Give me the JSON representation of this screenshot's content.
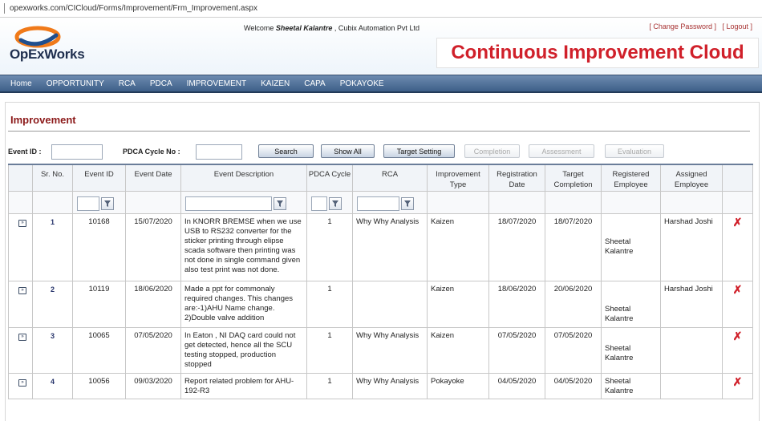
{
  "browser": {
    "url": "opexworks.com/CICloud/Forms/Improvement/Frm_Improvement.aspx"
  },
  "header": {
    "logo_text": "OpExWorks",
    "welcome_prefix": "Welcome ",
    "user_name": "Sheetal Kalantre",
    "company": " , Cubix Automation Pvt Ltd",
    "change_password": "[ Change Password ]",
    "logout": "[ Logout ]",
    "banner": "Continuous Improvement Cloud"
  },
  "nav": [
    "Home",
    "OPPORTUNITY",
    "RCA",
    "PDCA",
    "IMPROVEMENT",
    "KAIZEN",
    "CAPA",
    "POKAYOKE"
  ],
  "page": {
    "title": "Improvement",
    "event_id_label": "Event ID :",
    "pdca_label": "PDCA Cycle No :",
    "buttons": {
      "search": "Search",
      "show_all": "Show All",
      "target_setting": "Target Setting",
      "completion": "Completion",
      "assessment": "Assessment",
      "evaluation": "Evaluation"
    }
  },
  "grid": {
    "headers": {
      "sr_no": "Sr. No.",
      "event_id": "Event ID",
      "event_date": "Event Date",
      "event_desc": "Event Description",
      "pdca_cycle": "PDCA Cycle",
      "rca": "RCA",
      "imp_type": "Improvement Type",
      "reg_date": "Registration Date",
      "target_completion": "Target Completion",
      "reg_employee": "Registered Employee",
      "assigned_employee": "Assigned Employee"
    },
    "rows": [
      {
        "sr": "1",
        "event_id": "10168",
        "event_date": "15/07/2020",
        "desc": "In KNORR BREMSE when we use USB to RS232 converter for the sticker printing through elipse scada software then printing was not done in single command given also test print was not done.",
        "pdca": "1",
        "rca": "Why Why Analysis",
        "type": "Kaizen",
        "reg_date": "18/07/2020",
        "target": "18/07/2020",
        "reg_emp": "Sheetal Kalantre",
        "assigned": "Harshad Joshi"
      },
      {
        "sr": "2",
        "event_id": "10119",
        "event_date": "18/06/2020",
        "desc": "Made a ppt for commonaly required changes. This changes are:-1)AHU Name change. 2)Double valve addition",
        "pdca": "1",
        "rca": "",
        "type": "Kaizen",
        "reg_date": "18/06/2020",
        "target": "20/06/2020",
        "reg_emp": "Sheetal Kalantre",
        "assigned": "Harshad Joshi"
      },
      {
        "sr": "3",
        "event_id": "10065",
        "event_date": "07/05/2020",
        "desc": "In Eaton , NI DAQ card could not get detected, hence all the SCU testing stopped, production stopped",
        "pdca": "1",
        "rca": "Why Why Analysis",
        "type": "Kaizen",
        "reg_date": "07/05/2020",
        "target": "07/05/2020",
        "reg_emp": "Sheetal Kalantre",
        "assigned": ""
      },
      {
        "sr": "4",
        "event_id": "10056",
        "event_date": "09/03/2020",
        "desc": "Report related problem for AHU-192-R3",
        "pdca": "1",
        "rca": "Why Why Analysis",
        "type": "Pokayoke",
        "reg_date": "04/05/2020",
        "target": "04/05/2020",
        "reg_emp": "Sheetal Kalantre",
        "assigned": ""
      }
    ]
  },
  "icons": {
    "expand": "expand-icon",
    "filter": "filter-icon",
    "delete": "delete-icon"
  },
  "colors": {
    "nav_bg": "#3d5f88",
    "title": "#8c1a1a",
    "banner_text": "#d0202a",
    "delete": "#d0202a"
  }
}
